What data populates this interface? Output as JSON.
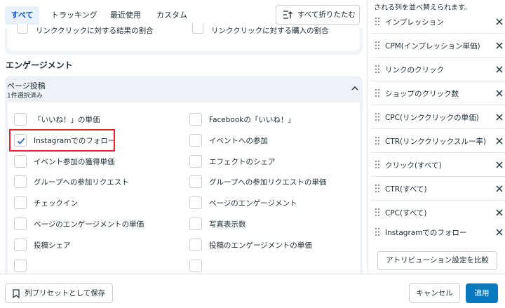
{
  "tabs": [
    {
      "label": "すべて",
      "active": true
    },
    {
      "label": "トラッキング",
      "active": false
    },
    {
      "label": "最近使用",
      "active": false
    },
    {
      "label": "カスタム",
      "active": false
    }
  ],
  "collapse_all_label": "すべて折りたたむ",
  "previous_group_cut_options": [
    "リンククリックに対する結果の割合",
    "リンククリックに対する購入の割合"
  ],
  "section_title": "エンゲージメント",
  "group": {
    "title": "ページ投稿",
    "subtitle": "1件選択済み",
    "options": [
      {
        "label": "「いいね！」の単価",
        "checked": false
      },
      {
        "label": "Facebookの「いいね！」",
        "checked": false
      },
      {
        "label": "Instagramでのフォロー",
        "checked": true
      },
      {
        "label": "イベントへの参加",
        "checked": false
      },
      {
        "label": "イベント参加の獲得単価",
        "checked": false
      },
      {
        "label": "エフェクトのシェア",
        "checked": false
      },
      {
        "label": "グループへの参加リクエスト",
        "checked": false
      },
      {
        "label": "グループへの参加リクエストの単価",
        "checked": false
      },
      {
        "label": "チェックイン",
        "checked": false
      },
      {
        "label": "ページのエンゲージメント",
        "checked": false
      },
      {
        "label": "ページのエンゲージメントの単価",
        "checked": false
      },
      {
        "label": "写真表示数",
        "checked": false
      },
      {
        "label": "投稿シェア",
        "checked": false
      },
      {
        "label": "投稿のエンゲージメントの単価",
        "checked": false
      }
    ]
  },
  "right_panel": {
    "header": "される列を並べ替えられます。",
    "columns": [
      "インプレッション",
      "CPM(インプレッション単価)",
      "リンクのクリック",
      "ショップのクリック数",
      "CPC(リンククリックの単価)",
      "CTR(リンククリックスルー率)",
      "クリック(すべて)",
      "CTR(すべて)",
      "CPC(すべて)",
      "Instagramでのフォロー"
    ],
    "compare_label": "アトリビューション設定を比較"
  },
  "footer": {
    "save_preset_label": "列プリセットとして保存",
    "cancel_label": "キャンセル",
    "apply_label": "適用"
  },
  "colors": {
    "accent": "#0a78be",
    "active_tab_text": "#0a5bd2",
    "active_tab_bg": "#e7f0fb",
    "highlight": "#e0262f",
    "group_bg": "#eef2f7"
  },
  "icons": {
    "collapse": "collapse-all-icon",
    "chevron": "chevron-up-icon",
    "checkbox": "checkmark-icon",
    "drag": "drag-handle-icon",
    "remove": "close-icon",
    "bookmark": "bookmark-icon"
  }
}
